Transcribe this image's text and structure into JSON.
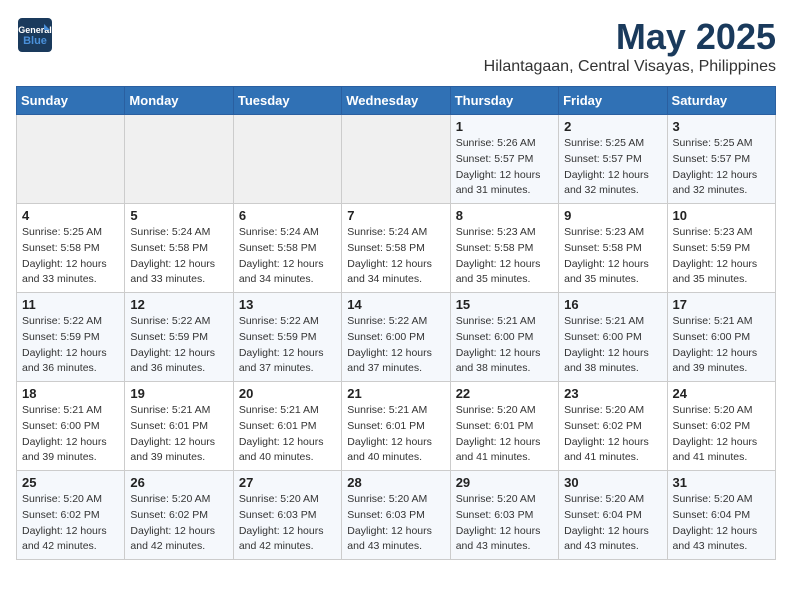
{
  "header": {
    "logo_line1": "General",
    "logo_line2": "Blue",
    "main_title": "May 2025",
    "subtitle": "Hilantagaan, Central Visayas, Philippines"
  },
  "days_of_week": [
    "Sunday",
    "Monday",
    "Tuesday",
    "Wednesday",
    "Thursday",
    "Friday",
    "Saturday"
  ],
  "weeks": [
    [
      {
        "day": "",
        "info": ""
      },
      {
        "day": "",
        "info": ""
      },
      {
        "day": "",
        "info": ""
      },
      {
        "day": "",
        "info": ""
      },
      {
        "day": "1",
        "info": "Sunrise: 5:26 AM\nSunset: 5:57 PM\nDaylight: 12 hours\nand 31 minutes."
      },
      {
        "day": "2",
        "info": "Sunrise: 5:25 AM\nSunset: 5:57 PM\nDaylight: 12 hours\nand 32 minutes."
      },
      {
        "day": "3",
        "info": "Sunrise: 5:25 AM\nSunset: 5:57 PM\nDaylight: 12 hours\nand 32 minutes."
      }
    ],
    [
      {
        "day": "4",
        "info": "Sunrise: 5:25 AM\nSunset: 5:58 PM\nDaylight: 12 hours\nand 33 minutes."
      },
      {
        "day": "5",
        "info": "Sunrise: 5:24 AM\nSunset: 5:58 PM\nDaylight: 12 hours\nand 33 minutes."
      },
      {
        "day": "6",
        "info": "Sunrise: 5:24 AM\nSunset: 5:58 PM\nDaylight: 12 hours\nand 34 minutes."
      },
      {
        "day": "7",
        "info": "Sunrise: 5:24 AM\nSunset: 5:58 PM\nDaylight: 12 hours\nand 34 minutes."
      },
      {
        "day": "8",
        "info": "Sunrise: 5:23 AM\nSunset: 5:58 PM\nDaylight: 12 hours\nand 35 minutes."
      },
      {
        "day": "9",
        "info": "Sunrise: 5:23 AM\nSunset: 5:58 PM\nDaylight: 12 hours\nand 35 minutes."
      },
      {
        "day": "10",
        "info": "Sunrise: 5:23 AM\nSunset: 5:59 PM\nDaylight: 12 hours\nand 35 minutes."
      }
    ],
    [
      {
        "day": "11",
        "info": "Sunrise: 5:22 AM\nSunset: 5:59 PM\nDaylight: 12 hours\nand 36 minutes."
      },
      {
        "day": "12",
        "info": "Sunrise: 5:22 AM\nSunset: 5:59 PM\nDaylight: 12 hours\nand 36 minutes."
      },
      {
        "day": "13",
        "info": "Sunrise: 5:22 AM\nSunset: 5:59 PM\nDaylight: 12 hours\nand 37 minutes."
      },
      {
        "day": "14",
        "info": "Sunrise: 5:22 AM\nSunset: 6:00 PM\nDaylight: 12 hours\nand 37 minutes."
      },
      {
        "day": "15",
        "info": "Sunrise: 5:21 AM\nSunset: 6:00 PM\nDaylight: 12 hours\nand 38 minutes."
      },
      {
        "day": "16",
        "info": "Sunrise: 5:21 AM\nSunset: 6:00 PM\nDaylight: 12 hours\nand 38 minutes."
      },
      {
        "day": "17",
        "info": "Sunrise: 5:21 AM\nSunset: 6:00 PM\nDaylight: 12 hours\nand 39 minutes."
      }
    ],
    [
      {
        "day": "18",
        "info": "Sunrise: 5:21 AM\nSunset: 6:00 PM\nDaylight: 12 hours\nand 39 minutes."
      },
      {
        "day": "19",
        "info": "Sunrise: 5:21 AM\nSunset: 6:01 PM\nDaylight: 12 hours\nand 39 minutes."
      },
      {
        "day": "20",
        "info": "Sunrise: 5:21 AM\nSunset: 6:01 PM\nDaylight: 12 hours\nand 40 minutes."
      },
      {
        "day": "21",
        "info": "Sunrise: 5:21 AM\nSunset: 6:01 PM\nDaylight: 12 hours\nand 40 minutes."
      },
      {
        "day": "22",
        "info": "Sunrise: 5:20 AM\nSunset: 6:01 PM\nDaylight: 12 hours\nand 41 minutes."
      },
      {
        "day": "23",
        "info": "Sunrise: 5:20 AM\nSunset: 6:02 PM\nDaylight: 12 hours\nand 41 minutes."
      },
      {
        "day": "24",
        "info": "Sunrise: 5:20 AM\nSunset: 6:02 PM\nDaylight: 12 hours\nand 41 minutes."
      }
    ],
    [
      {
        "day": "25",
        "info": "Sunrise: 5:20 AM\nSunset: 6:02 PM\nDaylight: 12 hours\nand 42 minutes."
      },
      {
        "day": "26",
        "info": "Sunrise: 5:20 AM\nSunset: 6:02 PM\nDaylight: 12 hours\nand 42 minutes."
      },
      {
        "day": "27",
        "info": "Sunrise: 5:20 AM\nSunset: 6:03 PM\nDaylight: 12 hours\nand 42 minutes."
      },
      {
        "day": "28",
        "info": "Sunrise: 5:20 AM\nSunset: 6:03 PM\nDaylight: 12 hours\nand 43 minutes."
      },
      {
        "day": "29",
        "info": "Sunrise: 5:20 AM\nSunset: 6:03 PM\nDaylight: 12 hours\nand 43 minutes."
      },
      {
        "day": "30",
        "info": "Sunrise: 5:20 AM\nSunset: 6:04 PM\nDaylight: 12 hours\nand 43 minutes."
      },
      {
        "day": "31",
        "info": "Sunrise: 5:20 AM\nSunset: 6:04 PM\nDaylight: 12 hours\nand 43 minutes."
      }
    ]
  ]
}
